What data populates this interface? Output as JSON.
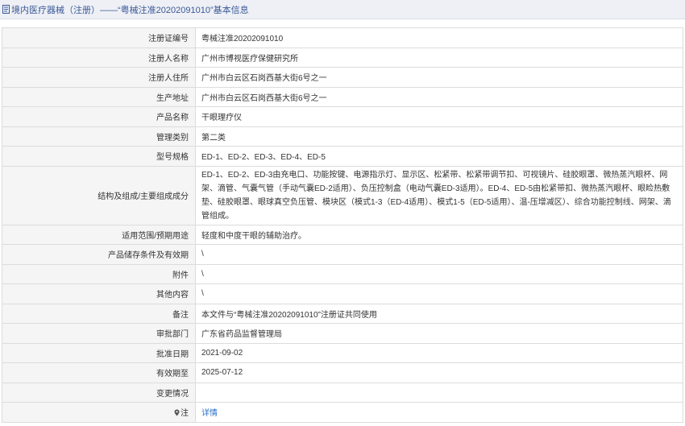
{
  "header": {
    "title": "境内医疗器械（注册）——“粤械注准20202091010”基本信息"
  },
  "rows": [
    {
      "label": "注册证编号",
      "value": "粤械注准20202091010"
    },
    {
      "label": "注册人名称",
      "value": "广州市博视医疗保健研究所"
    },
    {
      "label": "注册人住所",
      "value": "广州市白云区石岗西基大街6号之一"
    },
    {
      "label": "生产地址",
      "value": "广州市白云区石岗西基大街6号之一"
    },
    {
      "label": "产品名称",
      "value": "干眼理疗仪"
    },
    {
      "label": "管理类别",
      "value": "第二类"
    },
    {
      "label": "型号规格",
      "value": "ED-1、ED-2、ED-3、ED-4、ED-5"
    },
    {
      "label": "结构及组成/主要组成成分",
      "value": "ED-1、ED-2、ED-3由充电口、功能按键、电源指示灯、显示区、松紧带、松紧带调节扣、可视镜片、硅胶眼罩、微热蒸汽眼杯、网架、滴管、气囊气管（手动气囊ED-2适用）、负压控制盒（电动气囊ED-3适用）。ED-4、ED-5由松紧带扣、微热蒸汽眼杯、眼睑热敷垫、硅胶眼罩、眼球真空负压管、模块区（模式1-3（ED-4适用）、模式1-5（ED-5适用）、温-压增减区）、综合功能控制线、网架、滴管组成。"
    },
    {
      "label": "适用范围/预期用途",
      "value": "轻度和中度干眼的辅助治疗。"
    },
    {
      "label": "产品储存条件及有效期",
      "value": "\\"
    },
    {
      "label": "附件",
      "value": "\\"
    },
    {
      "label": "其他内容",
      "value": "\\"
    },
    {
      "label": "备注",
      "value": "本文件与“粤械注准20202091010”注册证共同使用"
    },
    {
      "label": "审批部门",
      "value": "广东省药品监督管理局"
    },
    {
      "label": "批准日期",
      "value": "2021-09-02"
    },
    {
      "label": "有效期至",
      "value": "2025-07-12"
    },
    {
      "label": "变更情况",
      "value": ""
    },
    {
      "label": "注",
      "value": "详情"
    }
  ],
  "icons": {
    "header_icon": "document-icon",
    "note_icon": "map-pin-icon"
  }
}
